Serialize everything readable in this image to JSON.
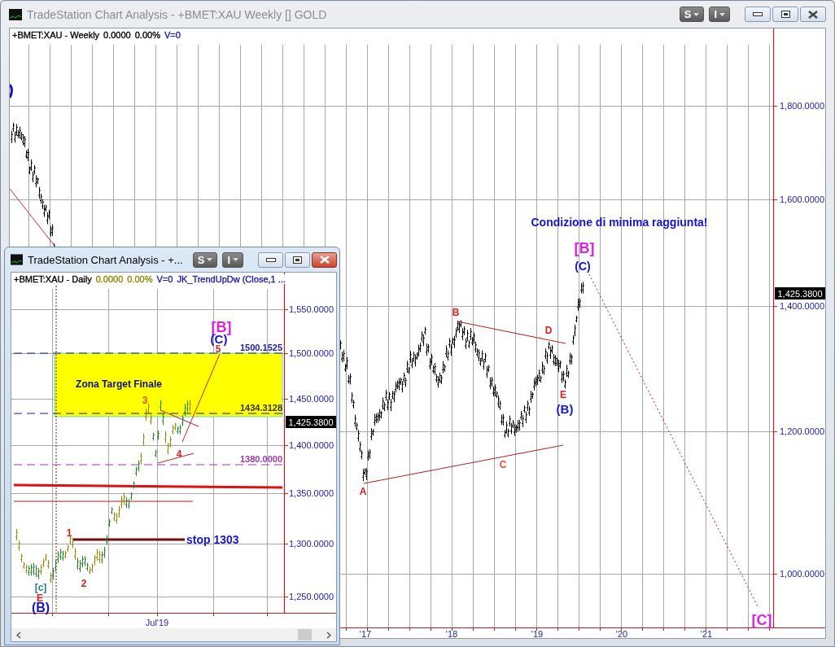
{
  "main_window": {
    "title": "TradeStation Chart Analysis - +BMET:XAU Weekly [] GOLD",
    "active": false,
    "menu_buttons": [
      "S",
      "I"
    ],
    "legend": [
      {
        "text": "+BMET:XAU - Weekly",
        "color": "#000000"
      },
      {
        "text": "0.0000"
      },
      {
        "text": "0.00%"
      },
      {
        "text": "V=0",
        "color": "#1a1aa6"
      }
    ],
    "price_axis": [
      "1,800.0000",
      "1,600.0000",
      "1,400.0000",
      "1,200.0000",
      "1,000.0000"
    ],
    "last_price": "1,425.3800",
    "time_axis": [
      "'17",
      "'18",
      "'19",
      "'20",
      "'21"
    ],
    "annotations": [
      {
        "text": "Condizione di minima raggiunta!",
        "color": "#1515c8"
      },
      {
        "text": "[B]",
        "color": "#e020e0"
      },
      {
        "text": "(C)",
        "color": "#1515c8"
      },
      {
        "text": "B",
        "color": "#e02020"
      },
      {
        "text": "D",
        "color": "#e02020"
      },
      {
        "text": "E",
        "color": "#e02020"
      },
      {
        "text": "(B)",
        "color": "#1515c8"
      },
      {
        "text": "C",
        "color": "#e05020"
      },
      {
        "text": "A",
        "color": "#e02020"
      },
      {
        "text": "[C]",
        "color": "#e020e0"
      }
    ]
  },
  "daily_window": {
    "title": "TradeStation Chart Analysis - +...",
    "active": true,
    "menu_buttons": [
      "S",
      "I"
    ],
    "legend": [
      {
        "text": "+BMET:XAU - Daily",
        "color": "#000000"
      },
      {
        "text": "0.0000",
        "color": "#8a8a00"
      },
      {
        "text": "0.00%",
        "color": "#8a8a00"
      },
      {
        "text": "V=0",
        "color": "#1a1aa6"
      },
      {
        "text": "JK_TrendUpDw (Close,1 ...",
        "color": "#1a1aa6"
      }
    ],
    "price_axis": [
      "1,550.0000",
      "1,500.0000",
      "1,450.0000",
      "1,400.0000",
      "1,350.0000",
      "1,300.0000",
      "1,250.0000"
    ],
    "last_price": "1,425.3800",
    "time_axis": [
      "Jul'19"
    ],
    "annotations": [
      {
        "text": "[B]",
        "color": "#e020e0"
      },
      {
        "text": "(C)",
        "color": "#1515c8"
      },
      {
        "text": "5",
        "color": "#e02020"
      },
      {
        "text": "Zona Target Finale",
        "color": "#10107a"
      },
      {
        "text": "3",
        "color": "#e05020"
      },
      {
        "text": "4",
        "color": "#e02020"
      },
      {
        "text": "1",
        "color": "#d02020"
      },
      {
        "text": "2",
        "color": "#d02020"
      },
      {
        "text": "[c]",
        "color": "#208888"
      },
      {
        "text": "E",
        "color": "#e02020"
      },
      {
        "text": "(B)",
        "color": "#1515c8"
      },
      {
        "text": "stop 1303",
        "color": "#1515c8"
      },
      {
        "text": "1500.1525",
        "color": "#1a1aa6"
      },
      {
        "text": "1434.3128",
        "color": "#333333"
      },
      {
        "text": "1380.0000",
        "color": "#9a3ab0"
      }
    ]
  }
}
